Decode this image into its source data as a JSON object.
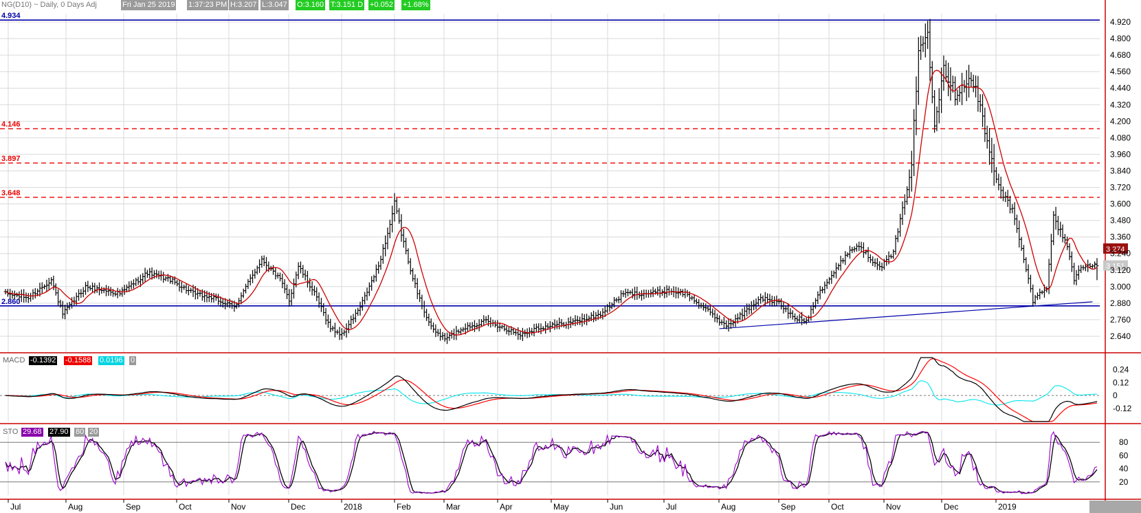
{
  "header": {
    "symbol": "NG(D10) ~ Daily, 0 Days Adj",
    "date": "Fri Jan 25 2019",
    "time": "1:37:23 PM",
    "high": "H:3.207",
    "low": "L:3.047",
    "open": "O:3.160",
    "close": "T:3.151 D",
    "change": "+0.052",
    "change_pct": "+1.68%"
  },
  "colors": {
    "price_bar": "#000000",
    "ma_line": "#cc0000",
    "support_line": "#0000aa",
    "resistance": "#ee0000",
    "macd_line": "#000000",
    "signal_line": "#ff0000",
    "histogram_line": "#00e5ee",
    "sto_k": "#9900cc",
    "sto_d": "#000000",
    "axis_line": "#cc0000",
    "grid": "#d9d9d9"
  },
  "chart_data": [
    {
      "type": "ohlc",
      "panel": "price",
      "y_ticks": [
        "4.920",
        "4.800",
        "4.680",
        "4.560",
        "4.440",
        "4.320",
        "4.200",
        "4.080",
        "3.960",
        "3.840",
        "3.720",
        "3.600",
        "3.480",
        "3.360",
        "3.240",
        "3.120",
        "3.000",
        "2.880",
        "2.760",
        "2.640"
      ],
      "ylim": [
        2.52,
        4.98
      ],
      "x_months": [
        "Jul",
        "Aug",
        "Sep",
        "Oct",
        "Nov",
        "Dec",
        "2018",
        "Feb",
        "Mar",
        "Apr",
        "May",
        "Jun",
        "Jul",
        "Aug",
        "Sep",
        "Oct",
        "Nov",
        "Dec",
        "2019"
      ],
      "anchors_trading_day_close": [
        [
          0,
          2.95
        ],
        [
          10,
          2.92
        ],
        [
          20,
          3.05
        ],
        [
          25,
          2.8
        ],
        [
          35,
          3.0
        ],
        [
          50,
          2.95
        ],
        [
          62,
          3.1
        ],
        [
          72,
          3.05
        ],
        [
          82,
          2.95
        ],
        [
          90,
          2.92
        ],
        [
          100,
          2.85
        ],
        [
          112,
          3.2
        ],
        [
          120,
          3.05
        ],
        [
          124,
          2.9
        ],
        [
          128,
          3.15
        ],
        [
          135,
          2.95
        ],
        [
          142,
          2.7
        ],
        [
          147,
          2.65
        ],
        [
          155,
          2.85
        ],
        [
          163,
          3.15
        ],
        [
          168,
          3.45
        ],
        [
          170,
          3.6
        ],
        [
          175,
          3.25
        ],
        [
          180,
          2.95
        ],
        [
          186,
          2.7
        ],
        [
          192,
          2.62
        ],
        [
          200,
          2.7
        ],
        [
          210,
          2.75
        ],
        [
          218,
          2.7
        ],
        [
          225,
          2.65
        ],
        [
          232,
          2.7
        ],
        [
          240,
          2.72
        ],
        [
          250,
          2.75
        ],
        [
          260,
          2.8
        ],
        [
          270,
          2.95
        ],
        [
          280,
          2.95
        ],
        [
          290,
          2.97
        ],
        [
          297,
          2.95
        ],
        [
          305,
          2.85
        ],
        [
          312,
          2.75
        ],
        [
          316,
          2.72
        ],
        [
          322,
          2.8
        ],
        [
          330,
          2.92
        ],
        [
          338,
          2.88
        ],
        [
          344,
          2.78
        ],
        [
          350,
          2.75
        ],
        [
          355,
          2.95
        ],
        [
          362,
          3.1
        ],
        [
          368,
          3.25
        ],
        [
          373,
          3.3
        ],
        [
          378,
          3.2
        ],
        [
          383,
          3.15
        ],
        [
          388,
          3.25
        ],
        [
          392,
          3.55
        ],
        [
          396,
          3.9
        ],
        [
          399,
          4.7
        ],
        [
          403,
          4.85
        ],
        [
          406,
          4.2
        ],
        [
          410,
          4.6
        ],
        [
          415,
          4.4
        ],
        [
          420,
          4.5
        ],
        [
          424,
          4.45
        ],
        [
          427,
          4.2
        ],
        [
          431,
          3.9
        ],
        [
          435,
          3.7
        ],
        [
          440,
          3.55
        ],
        [
          445,
          3.2
        ],
        [
          449,
          2.9
        ],
        [
          452,
          2.95
        ],
        [
          455,
          3.0
        ],
        [
          458,
          3.5
        ],
        [
          461,
          3.4
        ],
        [
          464,
          3.3
        ],
        [
          467,
          3.05
        ],
        [
          470,
          3.15
        ]
      ],
      "moving_average": {
        "name": "MA",
        "period": 10
      },
      "horizontal_levels": [
        {
          "label": "4.934",
          "value": 4.934,
          "style": "solid"
        },
        {
          "label": "4.146",
          "value": 4.146,
          "style": "dashed"
        },
        {
          "label": "3.897",
          "value": 3.897,
          "style": "dashed"
        },
        {
          "label": "3.648",
          "value": 3.648,
          "style": "dashed"
        },
        {
          "label": "2.860",
          "value": 2.86,
          "style": "solid"
        }
      ],
      "trendline": {
        "from_day": 312,
        "from_value": 2.695,
        "to_day": 475,
        "to_value": 2.89
      },
      "price_badges": [
        {
          "label": "3.274",
          "value": 3.274
        },
        {
          "label": "3.151",
          "value": 3.151
        }
      ]
    },
    {
      "type": "line",
      "panel": "macd",
      "title": "MACD",
      "values_shown": [
        "-0.1392",
        "-0.1588",
        "0.0196",
        "0"
      ],
      "y_ticks": [
        "0.24",
        "0.12",
        "0",
        "-0.12"
      ],
      "ylim": [
        -0.24,
        0.35
      ],
      "series": [
        "macd",
        "signal",
        "histogram"
      ]
    },
    {
      "type": "line",
      "panel": "stochastic",
      "title": "STO",
      "values_shown": [
        "29.68",
        "27.90",
        "80",
        "20"
      ],
      "y_ticks": [
        "80",
        "60",
        "40",
        "20"
      ],
      "ylim": [
        0,
        100
      ],
      "series": [
        "%K",
        "%D"
      ],
      "levels": [
        80,
        20
      ]
    }
  ]
}
